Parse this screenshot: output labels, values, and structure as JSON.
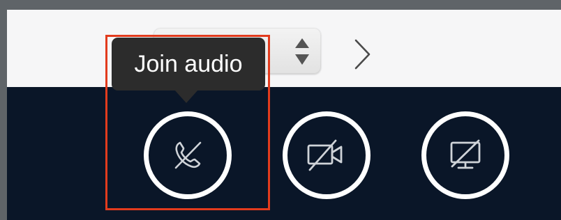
{
  "tooltip": {
    "text": "Join audio"
  },
  "controls": [
    {
      "name": "join-audio-button",
      "icon": "phone-off-icon",
      "highlighted": true
    },
    {
      "name": "start-video-button",
      "icon": "video-off-icon",
      "highlighted": false
    },
    {
      "name": "share-screen-button",
      "icon": "screen-share-off-icon",
      "highlighted": false
    }
  ],
  "select": {
    "icon": "select-updown-icon"
  },
  "navigation": {
    "next_icon": "chevron-right-icon"
  },
  "colors": {
    "toolbar_background": "#0a1628",
    "topbar_background": "#f6f6f7",
    "highlight_border": "#e23b1d",
    "tooltip_background": "#2c2c2c",
    "button_ring": "#ffffff"
  }
}
